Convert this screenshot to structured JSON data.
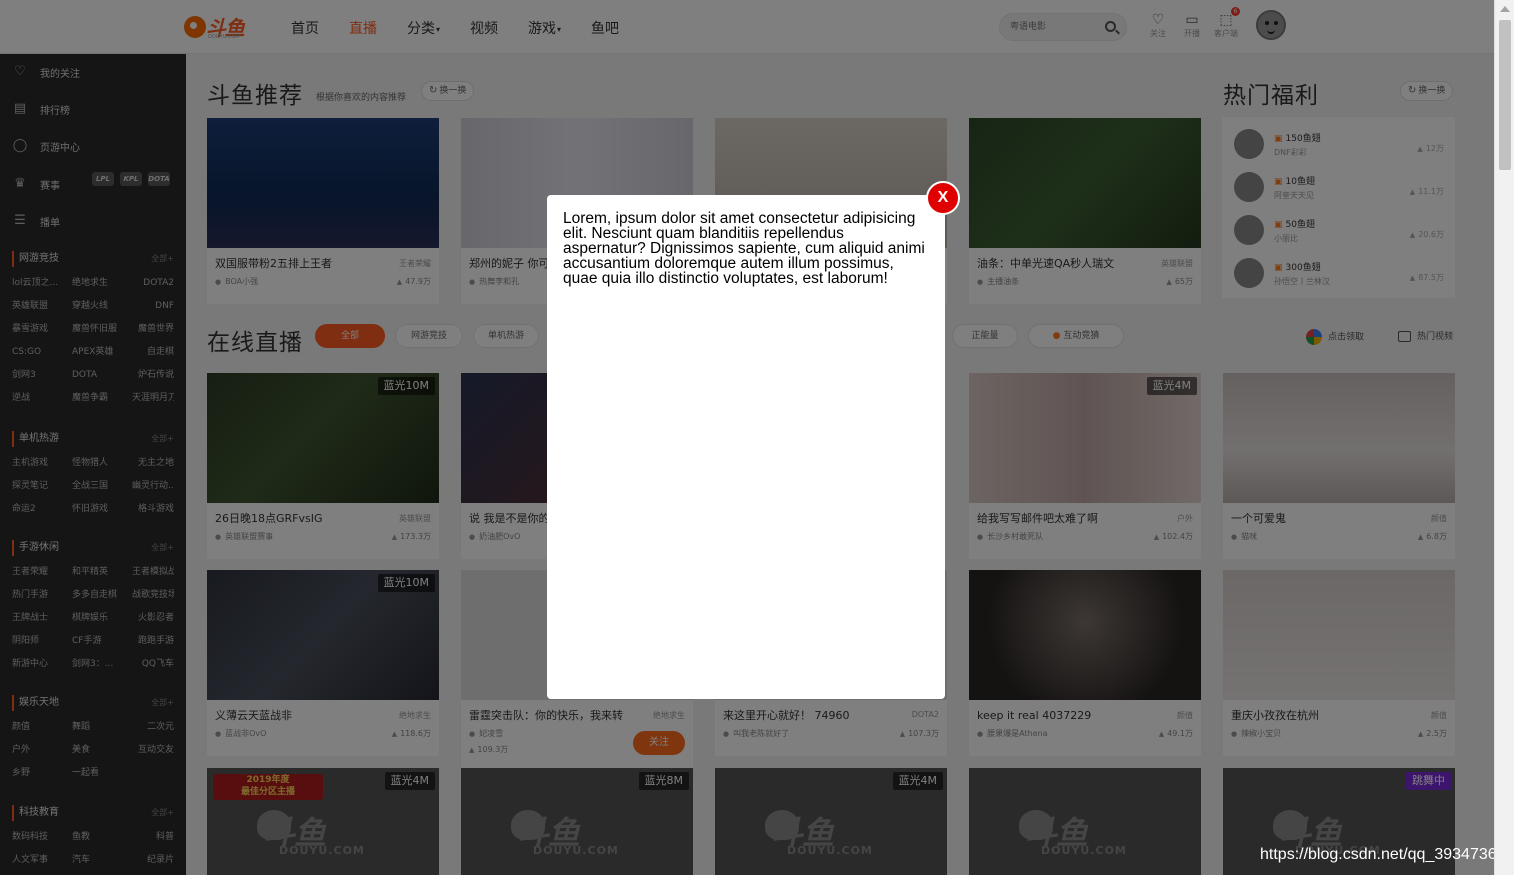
{
  "header": {
    "logo_text": "斗鱼",
    "logo_sub": "DOUYU.COM",
    "nav": [
      {
        "label": "首页",
        "caret": ""
      },
      {
        "label": "直播",
        "caret": ""
      },
      {
        "label": "分类",
        "caret": "▾"
      },
      {
        "label": "视频",
        "caret": ""
      },
      {
        "label": "游戏",
        "caret": "▾"
      },
      {
        "label": "鱼吧",
        "caret": ""
      }
    ],
    "search_placeholder": "粤语电影",
    "icons": [
      {
        "glyph": "♡",
        "label": "关注"
      },
      {
        "glyph": "▭",
        "label": "开播"
      },
      {
        "glyph": "⬚",
        "label": "客户端",
        "badge": "6"
      }
    ]
  },
  "sidebar": {
    "items": [
      {
        "glyph": "♡",
        "label": "我的关注"
      },
      {
        "glyph": "▤",
        "label": "排行榜"
      },
      {
        "glyph": "◯",
        "label": "页游中心"
      },
      {
        "glyph": "♛",
        "label": "赛事"
      },
      {
        "glyph": "☰",
        "label": "播单"
      }
    ],
    "event_logos": [
      "LPL",
      "KPL",
      "DOTA"
    ],
    "categories": [
      {
        "title": "网游竞技",
        "all": "全部+",
        "items": [
          "lol云顶之...",
          "绝地求生",
          "DOTA2",
          "英雄联盟",
          "穿越火线",
          "DNF",
          "暴雪游戏",
          "魔兽怀旧服",
          "魔兽世界",
          "CS:GO",
          "APEX英雄",
          "自走棋",
          "剑网3",
          "DOTA",
          "炉石传说",
          "逆战",
          "魔兽争霸",
          "天涯明月刀"
        ]
      },
      {
        "title": "单机热游",
        "all": "全部+",
        "items": [
          "主机游戏",
          "怪物猎人",
          "无主之地",
          "探灵笔记",
          "全战三国",
          "幽灵行动...",
          "命运2",
          "怀旧游戏",
          "格斗游戏"
        ]
      },
      {
        "title": "手游休闲",
        "all": "全部+",
        "items": [
          "王者荣耀",
          "和平精英",
          "王者模拟战",
          "热门手游",
          "多多自走棋",
          "战歌竞技场",
          "王牌战士",
          "棋牌娱乐",
          "火影忍者",
          "阴阳师",
          "CF手游",
          "跑跑手游",
          "新游中心",
          "剑网3：...",
          "QQ飞车"
        ]
      },
      {
        "title": "娱乐天地",
        "all": "全部+",
        "items": [
          "颜值",
          "舞蹈",
          "二次元",
          "户外",
          "美食",
          "互动交友",
          "乡野",
          "一起看"
        ]
      },
      {
        "title": "科技教育",
        "all": "全部+",
        "items": [
          "数码科技",
          "鱼教",
          "科普",
          "人文军事",
          "汽车",
          "纪录片"
        ]
      }
    ]
  },
  "recommend": {
    "title": "斗鱼推荐",
    "subtitle": "根据你喜欢的内容推荐",
    "swap": "换一换",
    "cards": [
      {
        "title": "双国服带粉2五排上王者",
        "cat": "王者荣耀",
        "owner": "BOA小强",
        "views": "47.9万"
      },
      {
        "title": "郑州的妮子 你可",
        "cat": "",
        "owner": "热舞李和孔",
        "views": ""
      },
      {
        "title": "",
        "cat": "",
        "owner": "",
        "views": ""
      },
      {
        "title": "油条：中单光速QA秒人瑞文",
        "cat": "英雄联盟",
        "owner": "主播油条",
        "views": "65万"
      }
    ]
  },
  "welfare": {
    "title": "热门福利",
    "swap": "换一换",
    "rows": [
      {
        "gift": "150鱼翅",
        "name": "DNF彩彩",
        "count": "12万"
      },
      {
        "gift": "10鱼翅",
        "name": "阿奎天天见",
        "count": "11.1万"
      },
      {
        "gift": "50鱼翅",
        "name": "小丽比",
        "count": "20.6万"
      },
      {
        "gift": "300鱼翅",
        "name": "孙悟空丨兰林汉",
        "count": "87.5万"
      }
    ]
  },
  "live": {
    "title": "在线直播",
    "tabs": [
      "全部",
      "网游竞技",
      "单机热游",
      "正能量",
      "互动竞猜"
    ],
    "right_links": [
      "点击领取",
      "热门视频"
    ],
    "cards": [
      {
        "title": "26日晚18点GRFvsIG",
        "cat": "英雄联盟",
        "owner": "英雄联盟赛事",
        "views": "173.3万",
        "badge": "蓝光10M"
      },
      {
        "title": "说 我是不是你的",
        "cat": "",
        "owner": "奶油肥OvO",
        "views": "",
        "badge": ""
      },
      {
        "title": "给我写写邮件吧太难了啊",
        "cat": "户外",
        "owner": "长沙乡村敢死队",
        "views": "102.4万",
        "badge": "蓝光4M"
      },
      {
        "title": "一个可爱鬼",
        "cat": "颜值",
        "owner": "猫咪",
        "views": "6.8万",
        "badge": ""
      },
      {
        "title": "义薄云天蓝战非",
        "cat": "绝地求生",
        "owner": "蓝战非OvO",
        "views": "118.6万",
        "badge": "蓝光10M"
      },
      {
        "title": "雷霆突击队：你的快乐，我来转",
        "cat": "绝地求生",
        "owner": "妃凌雪",
        "views": "109.3万",
        "badge": ""
      },
      {
        "title": "来这里开心就好！ 74960",
        "cat": "DOTA2",
        "owner": "叫我老陈就好了",
        "views": "107.3万",
        "badge": ""
      },
      {
        "title": "keep it real 4037229",
        "cat": "颜值",
        "owner": "腰果爆是Athena",
        "views": "49.1万",
        "badge": ""
      },
      {
        "title": "重庆小孜孜在杭州",
        "cat": "颜值",
        "owner": "辣椒小宝贝",
        "views": "2.5万",
        "badge": ""
      }
    ],
    "follow": "关注",
    "bottom_badges": [
      "蓝光4M",
      "蓝光8M",
      "蓝光4M",
      "",
      "跳舞中"
    ],
    "banner_text": "2019年度\n最佳分区主播",
    "placeholder_logo": "斗鱼",
    "placeholder_sub": "DOUYU.COM"
  },
  "modal": {
    "text": "Lorem, ipsum dolor sit amet consectetur adipisicing elit. Nesciunt quam blanditiis repellendus aspernatur? Dignissimos sapiente, cum aliquid animi accusantium doloremque autem illum possimus, quae quia illo distinctio voluptates, est laborum!",
    "close": "X"
  },
  "watermark": "https://blog.csdn.net/qq_3934736",
  "colors": {
    "accent": "#ff5d23",
    "close": "#e00000",
    "sidebar": "#2b2b2b"
  }
}
